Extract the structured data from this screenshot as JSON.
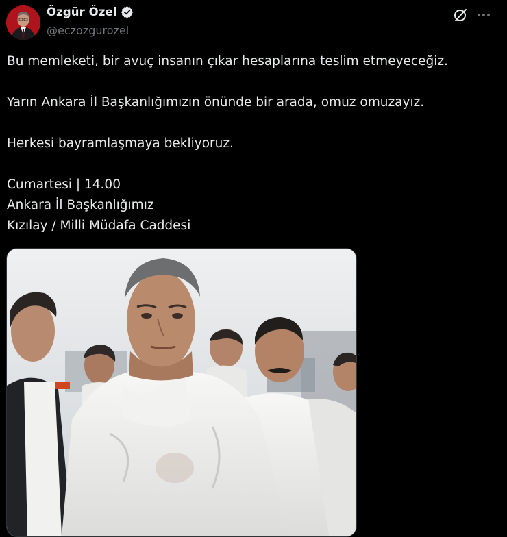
{
  "post": {
    "author": {
      "display_name": "Özgür Özel",
      "handle": "@eczozgurozel",
      "verified": true,
      "avatar_icon": "profile-photo"
    },
    "actions": {
      "grok_icon": "grok-icon",
      "more_icon": "more-icon"
    },
    "text_lines": [
      "Bu memleketi, bir avuç insanın çıkar hesaplarına teslim etmeyeceğiz.",
      "Yarın Ankara İl Başkanlığımızın önünde bir arada, omuz omuzayız.",
      "Herkesi bayramlaşmaya bekliyoruz.",
      "Cumartesi | 14.00",
      "Ankara İl Başkanlığımız",
      "Kızılay / Milli Müdafa Caddesi"
    ],
    "media": {
      "type": "photo"
    }
  },
  "colors": {
    "background": "#000000",
    "text_primary": "#e7e9ea",
    "text_secondary": "#71767b",
    "verified": "#e7e9ea",
    "border": "#2f3336"
  }
}
